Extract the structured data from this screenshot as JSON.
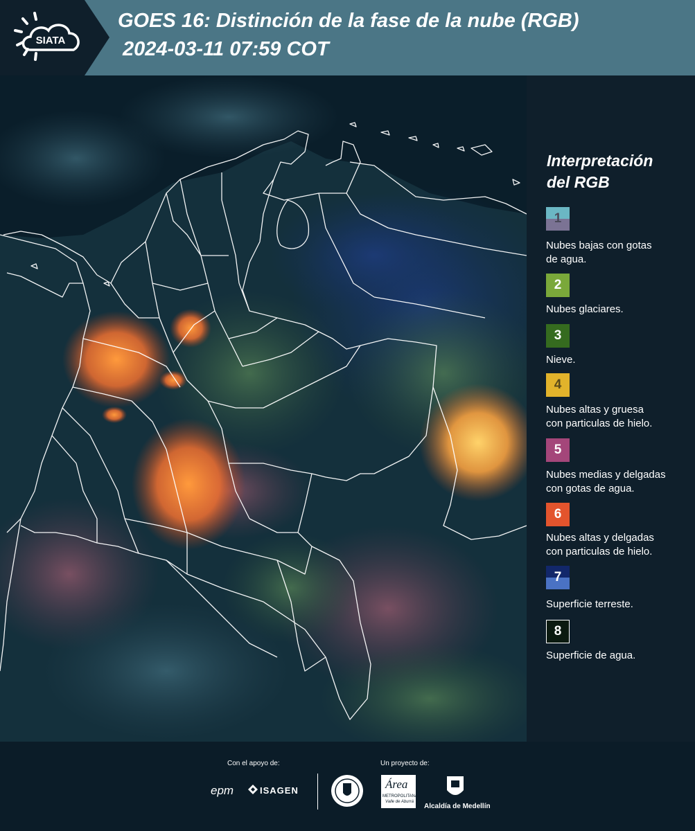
{
  "header": {
    "logo_text": "SIATA",
    "title": "GOES 16: Distinción de la fase de la nube (RGB)",
    "datetime": "2024-03-11 07:59 COT"
  },
  "legend": {
    "title_line1": "Interpretación",
    "title_line2": "del RGB",
    "items": [
      {
        "number": "1",
        "label_line1": "Nubes bajas con gotas",
        "label_line2": "de agua.",
        "color_top": "#6bb7c4",
        "color_bottom": "#7b7394",
        "text_color": "#4a4a5a"
      },
      {
        "number": "2",
        "label_line1": "Nubes glaciares.",
        "label_line2": "",
        "color_top": "#7aa83a",
        "color_bottom": "#7aa83a",
        "text_color": "#ffffff"
      },
      {
        "number": "3",
        "label_line1": "Nieve.",
        "label_line2": "",
        "color_top": "#356b1f",
        "color_bottom": "#356b1f",
        "text_color": "#ffffff"
      },
      {
        "number": "4",
        "label_line1": "Nubes altas y gruesa",
        "label_line2": "con particulas de hielo.",
        "color_top": "#e2b32b",
        "color_bottom": "#e2b32b",
        "text_color": "#5a4a1a"
      },
      {
        "number": "5",
        "label_line1": "Nubes medias y delgadas",
        "label_line2": "con gotas de agua.",
        "color_top": "#a4467a",
        "color_bottom": "#a4467a",
        "text_color": "#ffffff"
      },
      {
        "number": "6",
        "label_line1": "Nubes altas y delgadas",
        "label_line2": "con particulas de hielo.",
        "color_top": "#e3542d",
        "color_bottom": "#e3542d",
        "text_color": "#ffffff"
      },
      {
        "number": "7",
        "label_line1": "Superficie terreste.",
        "label_line2": "",
        "color_top": "#12276a",
        "color_bottom": "#4a72c4",
        "text_color": "#ffffff"
      },
      {
        "number": "8",
        "label_line1": "Superficie de agua.",
        "label_line2": "",
        "color_top": "#0b1a10",
        "color_bottom": "#0b1a10",
        "text_color": "#ffffff"
      }
    ]
  },
  "footer": {
    "support_label": "Con el apoyo de:",
    "project_label": "Un proyecto de:",
    "sponsor_epm": "epm",
    "sponsor_isagen": "ISAGEN",
    "partner_area": "Área",
    "partner_area_sub1": "METROPOLITANA",
    "partner_area_sub2": "Valle de Aburrá",
    "partner_alcaldia": "Alcaldía de Medellín"
  },
  "colors": {
    "header_bg": "#4b7686",
    "panel_bg": "#0f1f2b",
    "map_bg": "#0f2230"
  }
}
